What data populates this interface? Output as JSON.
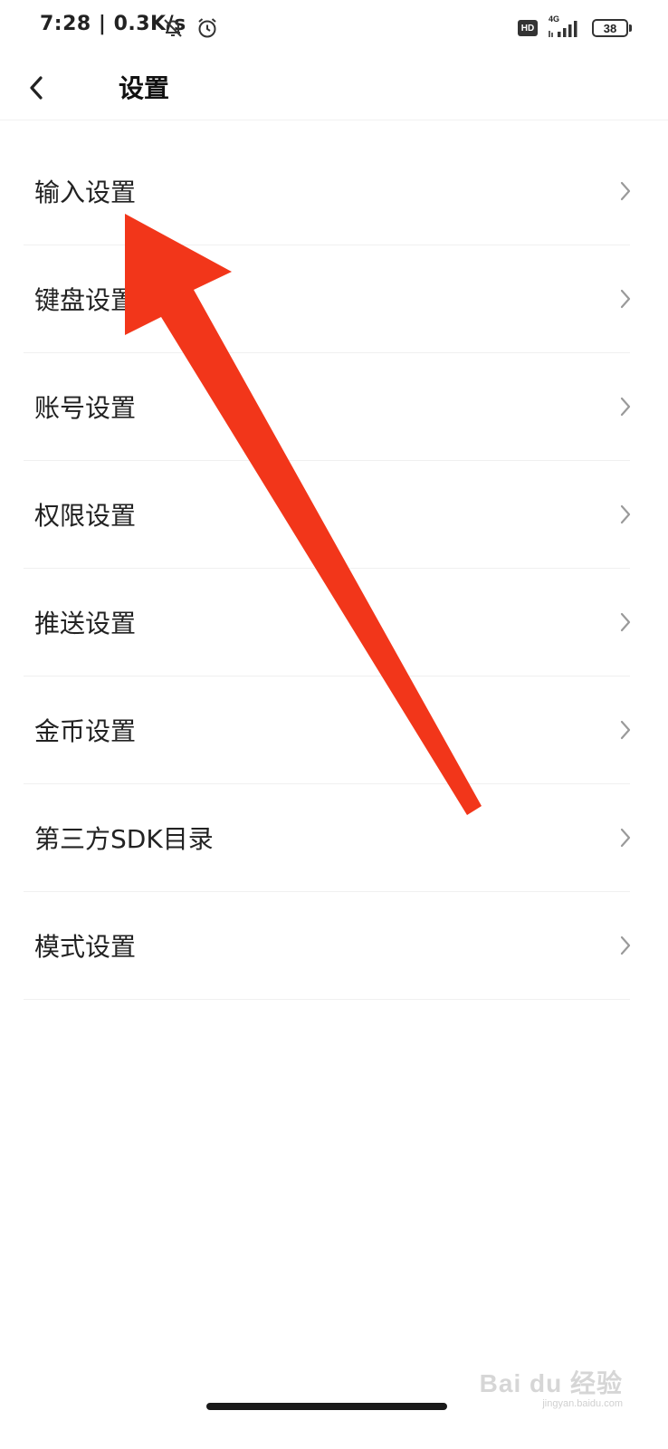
{
  "status_bar": {
    "time_speed": "7:28 | 0.3K/s",
    "hd_badge": "HD",
    "network": "4G",
    "battery": "38",
    "icons": [
      "mute-bell-icon",
      "alarm-icon",
      "signal-icon"
    ]
  },
  "header": {
    "back_icon": "chevron-left-icon",
    "title": "设置"
  },
  "settings": {
    "items": [
      {
        "label": "输入设置"
      },
      {
        "label": "键盘设置"
      },
      {
        "label": "账号设置"
      },
      {
        "label": "权限设置"
      },
      {
        "label": "推送设置"
      },
      {
        "label": "金币设置"
      },
      {
        "label": "第三方SDK目录"
      },
      {
        "label": "模式设置"
      }
    ],
    "chevron_icon": "chevron-right-icon"
  },
  "annotation": {
    "color": "#f2361a"
  },
  "watermark": {
    "logo": "Bai du 经验",
    "url": "jingyan.baidu.com"
  }
}
